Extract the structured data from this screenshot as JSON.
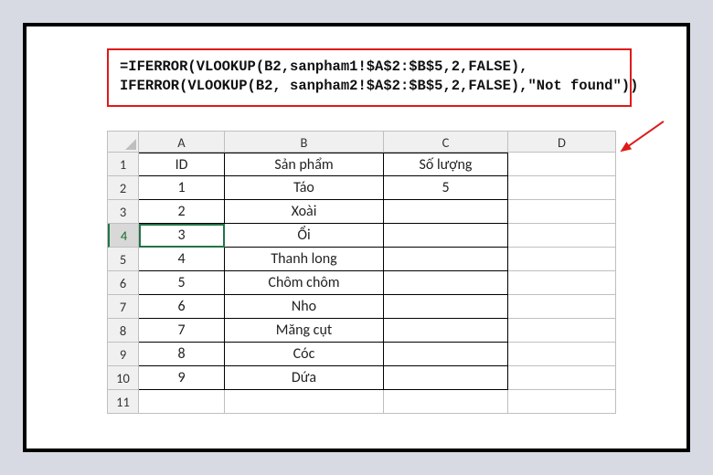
{
  "formula": {
    "line1": "=IFERROR(VLOOKUP(B2,sanpham1!$A$2:$B$5,2,FALSE),",
    "line2": "IFERROR(VLOOKUP(B2, sanpham2!$A$2:$B$5,2,FALSE),\"Not found\"))"
  },
  "columns": [
    "A",
    "B",
    "C",
    "D"
  ],
  "rowNumbers": [
    "1",
    "2",
    "3",
    "4",
    "5",
    "6",
    "7",
    "8",
    "9",
    "10",
    "11"
  ],
  "headerRow": {
    "a": "ID",
    "b": "Sản phẩm",
    "c": "Số lượng"
  },
  "data": [
    {
      "a": "1",
      "b": "Táo",
      "c": "5"
    },
    {
      "a": "2",
      "b": "Xoài",
      "c": ""
    },
    {
      "a": "3",
      "b": "Ổi",
      "c": ""
    },
    {
      "a": "4",
      "b": "Thanh long",
      "c": ""
    },
    {
      "a": "5",
      "b": "Chôm chôm",
      "c": ""
    },
    {
      "a": "6",
      "b": "Nho",
      "c": ""
    },
    {
      "a": "7",
      "b": "Măng cụt",
      "c": ""
    },
    {
      "a": "8",
      "b": "Cóc",
      "c": ""
    },
    {
      "a": "9",
      "b": "Dứa",
      "c": ""
    }
  ],
  "selectedRow": 4
}
